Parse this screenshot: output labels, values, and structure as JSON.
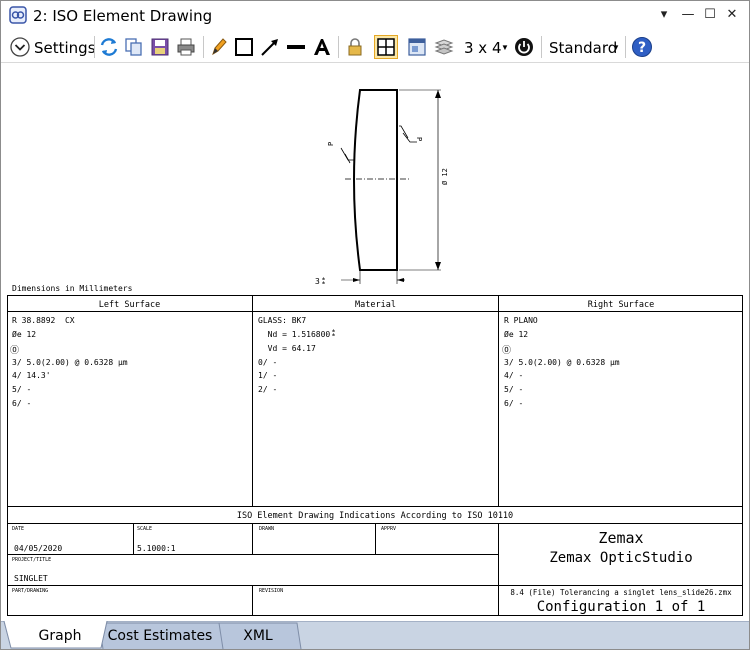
{
  "window": {
    "title": "2: ISO Element Drawing",
    "minimize_glyph": "▾",
    "min_glyph": "—",
    "max_glyph": "☐",
    "close_glyph": "✕"
  },
  "toolbar": {
    "settings_label": "Settings",
    "grid_label": "3 x 4",
    "standard_label": "Standard",
    "caret": "▼"
  },
  "drawing": {
    "dimensions_note": "Dimensions in Millimeters",
    "diameter_label": "Ø 12",
    "p_label": "P",
    "thickness_label": "3",
    "table": {
      "headers": [
        "Left Surface",
        "Material",
        "Right Surface"
      ],
      "left": [
        "R 38.8892  CX",
        "Øe 12",
        "⓪",
        "3/ 5.0(2.00) @ 0.6328 µm",
        "4/ 14.3'",
        "5/ -",
        "6/ -"
      ],
      "material": [
        "GLASS: BK7",
        "  Nd = 1.516800",
        "  Vd = 64.17",
        "0/ -",
        "1/ -",
        "2/ -"
      ],
      "right": [
        "R PLANO",
        "Øe 12",
        "⓪",
        "3/ 5.0(2.00) @ 0.6328 µm",
        "4/ -",
        "5/ -",
        "6/ -"
      ]
    },
    "title_block": {
      "indications": "ISO Element Drawing Indications According to ISO 10110",
      "date_label": "DATE",
      "date_value": "04/05/2020",
      "scale_label": "SCALE",
      "scale_value": "5.1000:1",
      "drawn_label": "DRAWN",
      "apprv_label": "APPRV",
      "project_label": "PROJECT/TITLE",
      "project_value": "SINGLET",
      "part_label": "PART/DRAWING",
      "revision_label": "REVISION",
      "company": "Zemax",
      "product": "Zemax OpticStudio",
      "file_line": "8.4 (File) Tolerancing a singlet lens_slide26.zmx",
      "configuration": "Configuration 1 of 1"
    }
  },
  "tabs": [
    "Graph",
    "Cost Estimates",
    "XML"
  ]
}
